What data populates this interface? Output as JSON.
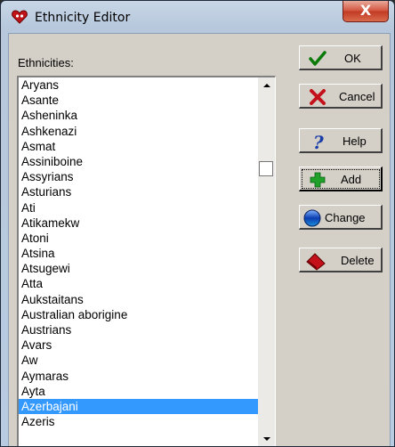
{
  "window": {
    "title": "Ethnicity Editor",
    "close_label": "X"
  },
  "list": {
    "label": "Ethnicities:",
    "items": [
      "Aryans",
      "Asante",
      "Asheninka",
      "Ashkenazi",
      "Asmat",
      "Assiniboine",
      "Assyrians",
      "Asturians",
      "Ati",
      "Atikamekw",
      "Atoni",
      "Atsina",
      "Atsugewi",
      "Atta",
      "Aukstaitans",
      "Australian aborigine",
      "Austrians",
      "Avars",
      "Aw",
      "Aymaras",
      "Ayta",
      "Azerbajani",
      "Azeris"
    ],
    "selected": "Azerbajani"
  },
  "buttons": {
    "ok": {
      "label": "OK",
      "icon": "checkmark-icon"
    },
    "cancel": {
      "label": "Cancel",
      "icon": "red-x-icon"
    },
    "help": {
      "label": "Help",
      "icon": "question-icon"
    },
    "add": {
      "label": "Add",
      "icon": "green-plus-icon"
    },
    "change": {
      "label": "Change",
      "icon": "globe-icon"
    },
    "delete": {
      "label": "Delete",
      "icon": "eraser-icon"
    }
  },
  "colors": {
    "selection": "#3399ff",
    "face": "#d4d0c8"
  }
}
